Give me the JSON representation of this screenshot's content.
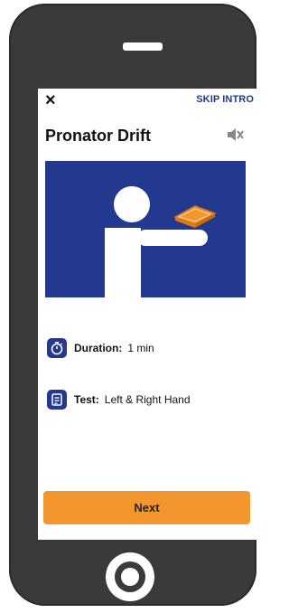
{
  "header": {
    "close_label": "×",
    "skip_label": "SKIP INTRO",
    "title": "Pronator Drift"
  },
  "info": {
    "duration_label": "Duration:",
    "duration_value": "1 min",
    "test_label": "Test:",
    "test_value": "Left & Right Hand"
  },
  "footer": {
    "next_label": "Next"
  },
  "colors": {
    "accent_blue": "#22398f",
    "button_orange": "#f2962d",
    "phone_body": "#3a3a3a"
  },
  "icons": [
    "close-icon",
    "mute-speaker-icon",
    "timer-icon",
    "test-checklist-icon",
    "home-button-icon"
  ]
}
